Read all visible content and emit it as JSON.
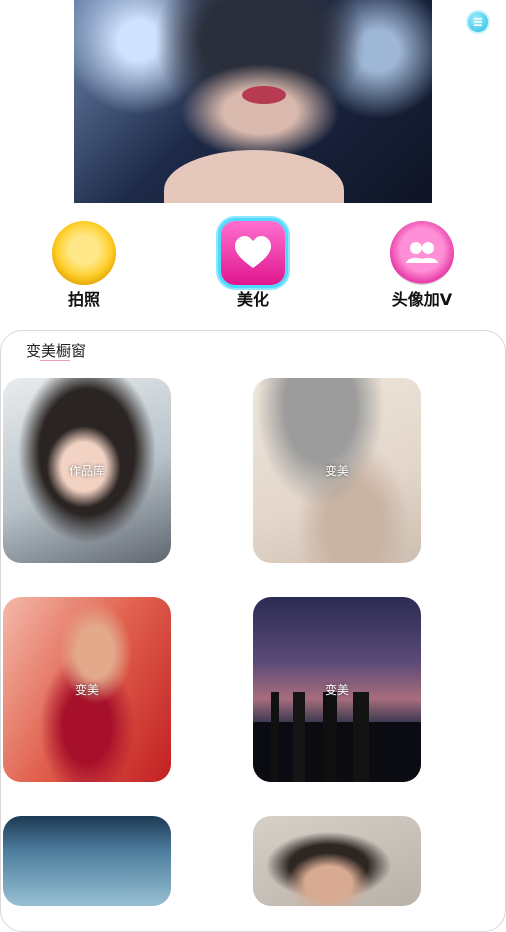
{
  "features": [
    {
      "label": "拍照",
      "icon": "camera-ball-icon"
    },
    {
      "label": "美化",
      "icon": "heart-icon"
    },
    {
      "label": "头像加V",
      "icon": "avatar-v-icon"
    }
  ],
  "showcase": {
    "title": "变美橱窗",
    "tiles": [
      {
        "caption": "作品库"
      },
      {
        "caption": "变美"
      },
      {
        "caption": "变美"
      },
      {
        "caption": "变美"
      },
      {
        "caption": ""
      },
      {
        "caption": ""
      }
    ]
  },
  "colors": {
    "accent_pink": "#e83aa8",
    "accent_cyan": "#29b9e6",
    "accent_yellow": "#ffcc22"
  }
}
